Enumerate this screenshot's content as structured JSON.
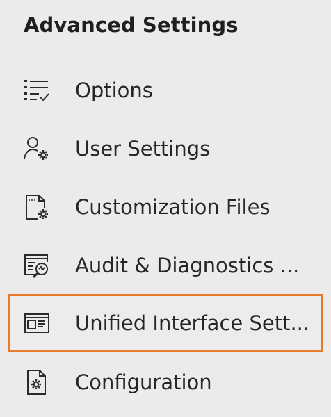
{
  "panel": {
    "title": "Advanced Settings"
  },
  "colors": {
    "background": "#ebebeb",
    "text": "#262626",
    "selection_border": "#e87b2a"
  },
  "menu": {
    "items": [
      {
        "label": "Options",
        "icon": "checklist-icon",
        "selected": false
      },
      {
        "label": "User Settings",
        "icon": "user-gear-icon",
        "selected": false
      },
      {
        "label": "Customization Files",
        "icon": "file-gear-icon",
        "selected": false
      },
      {
        "label": "Audit & Diagnostics ...",
        "icon": "audit-diagnostics-icon",
        "selected": false
      },
      {
        "label": "Unified Interface Sett...",
        "icon": "unified-interface-icon",
        "selected": true
      },
      {
        "label": "Configuration",
        "icon": "config-file-gear-icon",
        "selected": false
      }
    ]
  }
}
